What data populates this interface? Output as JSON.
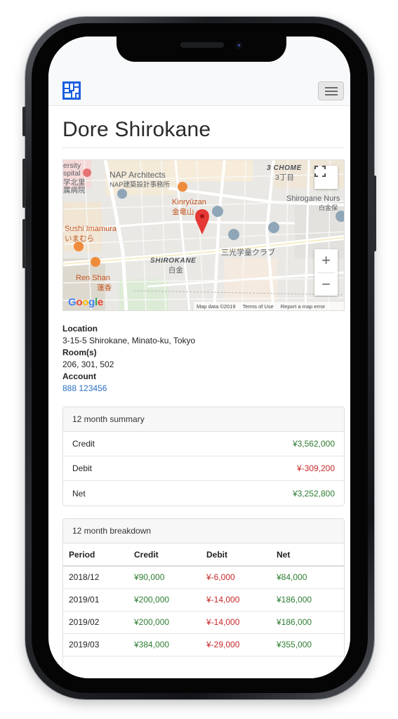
{
  "page": {
    "title": "Dore Shirokane"
  },
  "colors": {
    "positive": "#2e7d32",
    "negative": "#c62828",
    "link": "#2a6fc0",
    "brand": "#1a5fe0"
  },
  "map": {
    "labels": {
      "university": "ersity",
      "hospital": "spital",
      "hospital_jp1": "学北里",
      "hospital_jp2": "属病院",
      "nap": "NAP Architects",
      "nap_jp": "NAP建築設計事務所",
      "chome": "3 CHOME",
      "chome_jp": "3丁目",
      "kinryuzan": "Kinryūzan",
      "kinryuzan_jp": "金竜山",
      "shirogane": "Shirogane Nurs",
      "shirogane_jp": "白金保",
      "sushi": "Sushi Imamura",
      "sushi_jp": "いまむら",
      "sanko": "三光学童クラブ",
      "shirokane": "SHIROKANE",
      "shirokane_jp": "白金",
      "renshan": "Ren Shan",
      "renshan_jp": "蓮香"
    },
    "google": "Google",
    "footer": {
      "map_data": "Map data ©2019",
      "terms": "Terms of Use",
      "report": "Report a map error"
    },
    "zoom_in": "+",
    "zoom_out": "−"
  },
  "info": {
    "location_label": "Location",
    "location_value": "3-15-5 Shirokane, Minato-ku, Tokyo",
    "rooms_label": "Room(s)",
    "rooms_value": "206, 301, 502",
    "account_label": "Account",
    "account_value": "888 123456"
  },
  "summary": {
    "header": "12 month summary",
    "rows": [
      {
        "label": "Credit",
        "value": "¥3,562,000"
      },
      {
        "label": "Debit",
        "value": "¥-309,200"
      },
      {
        "label": "Net",
        "value": "¥3,252,800"
      }
    ]
  },
  "breakdown": {
    "header": "12 month breakdown",
    "columns": [
      "Period",
      "Credit",
      "Debit",
      "Net"
    ],
    "rows": [
      [
        "2018/12",
        "¥90,000",
        "¥-6,000",
        "¥84,000"
      ],
      [
        "2019/01",
        "¥200,000",
        "¥-14,000",
        "¥186,000"
      ],
      [
        "2019/02",
        "¥200,000",
        "¥-14,000",
        "¥186,000"
      ],
      [
        "2019/03",
        "¥384,000",
        "¥-29,000",
        "¥355,000"
      ]
    ]
  }
}
